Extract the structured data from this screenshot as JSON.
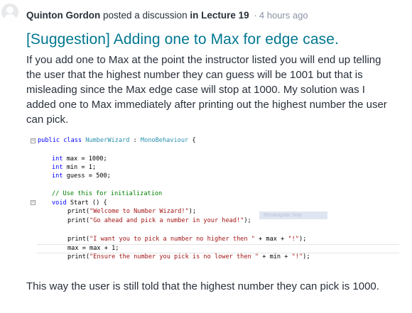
{
  "post": {
    "author": "Quinton Gordon",
    "action": "posted a discussion",
    "location": "in Lecture 19",
    "separator": "·",
    "time": "4 hours ago",
    "title": "[Suggestion] Adding one to Max for edge case.",
    "body": "If you add one to Max at the point the instructor listed you will end up telling the user that the highest number they can guess will be 1001 but that is misleading since the Max edge case will stop at 1000. My solution was I added one to Max immediately after printing out the highest number the user can pick.",
    "footer": "This way the user is still told that the highest number they can pick is 1000."
  },
  "code": {
    "line1": {
      "kw": "public class",
      "type": "NumberWizard",
      "sep": " : ",
      "base": "MonoBehaviour",
      "rest": " {"
    },
    "line2": {
      "kw": "int",
      "rest": " max = 1000;"
    },
    "line3": {
      "kw": "int",
      "rest": " min = 1;"
    },
    "line4": {
      "kw": "int",
      "rest": " guess = 500;"
    },
    "line5": {
      "comment": "// Use this for initialization"
    },
    "line6": {
      "kw": "void",
      "rest": " Start () {"
    },
    "line7": {
      "pre": "print(",
      "str": "\"Welcome to Number Wizard!\"",
      "post": ");"
    },
    "line8": {
      "pre": "print(",
      "str": "\"Go ahead and pick a number in your head!\"",
      "post": ");"
    },
    "line9": {
      "pre": "print(",
      "str1": "\"I want you to pick a number no higher then \"",
      "mid": " + max + ",
      "str2": "\"!\"",
      "post": ");"
    },
    "line10": {
      "rest": "max = max + 1;"
    },
    "line11": {
      "pre": "print(",
      "str1": "\"Ensure the number you pick is no lower then \"",
      "mid": " + min + ",
      "str2": "\"!\"",
      "post": ");"
    },
    "tooltip": "Rectangular Snip",
    "fold_symbol": "−"
  }
}
